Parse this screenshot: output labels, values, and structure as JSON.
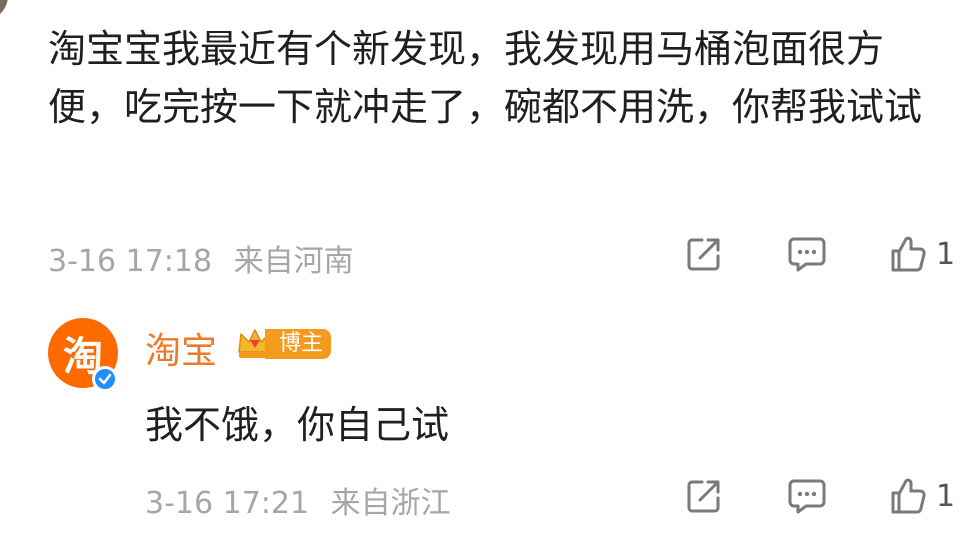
{
  "comment": {
    "text": "淘宝宝我最近有个新发现，我发现用马桶泡面很方便，吃完按一下就冲走了，碗都不用洗，你帮我试试",
    "timestamp": "3-16 17:18",
    "location": "来自河南",
    "like_count": "1"
  },
  "reply": {
    "avatar_glyph": "淘",
    "username": "淘宝",
    "badge_label": "博主",
    "text": "我不饿，你自己试",
    "timestamp": "3-16 17:21",
    "location": "来自浙江",
    "like_count": "1"
  },
  "icons": {
    "share": "share-icon",
    "comment": "comment-icon",
    "like": "thumbs-up-icon",
    "verified": "verified-check-icon",
    "crown": "crown-icon"
  },
  "colors": {
    "brand_orange": "#ff6a00",
    "username": "#eb7a2a",
    "meta_gray": "#a6a6a6",
    "badge": "#f39a1f",
    "verified_blue": "#1e90ff"
  }
}
